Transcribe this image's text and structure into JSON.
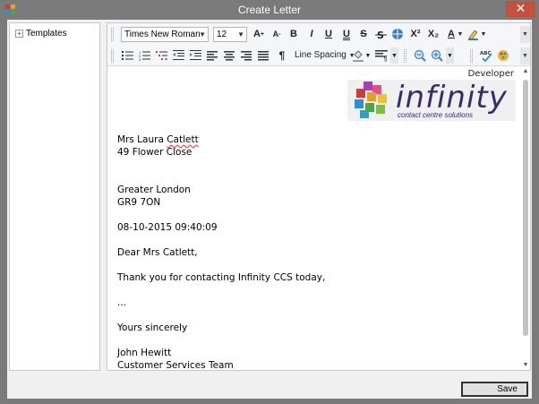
{
  "window": {
    "title": "Create Letter",
    "close_glyph": "✕",
    "app_icon": "infinity-cubes-icon",
    "title_color": "#7a7a7a",
    "close_color": "#c7503c"
  },
  "tree": {
    "expander": "+",
    "root_label": "Templates"
  },
  "toolbar": {
    "font_family": "Times New Roman",
    "font_size": "12",
    "grow_font": "A",
    "shrink_font": "A",
    "bold": "B",
    "italic": "I",
    "underline": "U",
    "double_underline": "U",
    "strike": "S",
    "superscript": "X²",
    "subscript": "X₂",
    "font_color": "A",
    "line_spacing": "Line Spacing",
    "paragraph_mark": "¶"
  },
  "document": {
    "logo": {
      "developer": "Developer",
      "word": "infinity",
      "tagline": "contact centre solutions"
    },
    "name_prefix": "Mrs Laura ",
    "name_surname": "Catlett",
    "address1": "49 Flower Close",
    "county": "Greater London",
    "postcode": "GR9 7ON",
    "datetime": "08-10-2015 09:40:09",
    "salutation": "Dear Mrs Catlett,",
    "body": "Thank you for contacting Infinity CCS today,",
    "ellipsis": "...",
    "signoff": "Yours sincerely",
    "signer": "John Hewitt",
    "team": "Customer Services Team"
  },
  "footer": {
    "save_label": "Save"
  }
}
